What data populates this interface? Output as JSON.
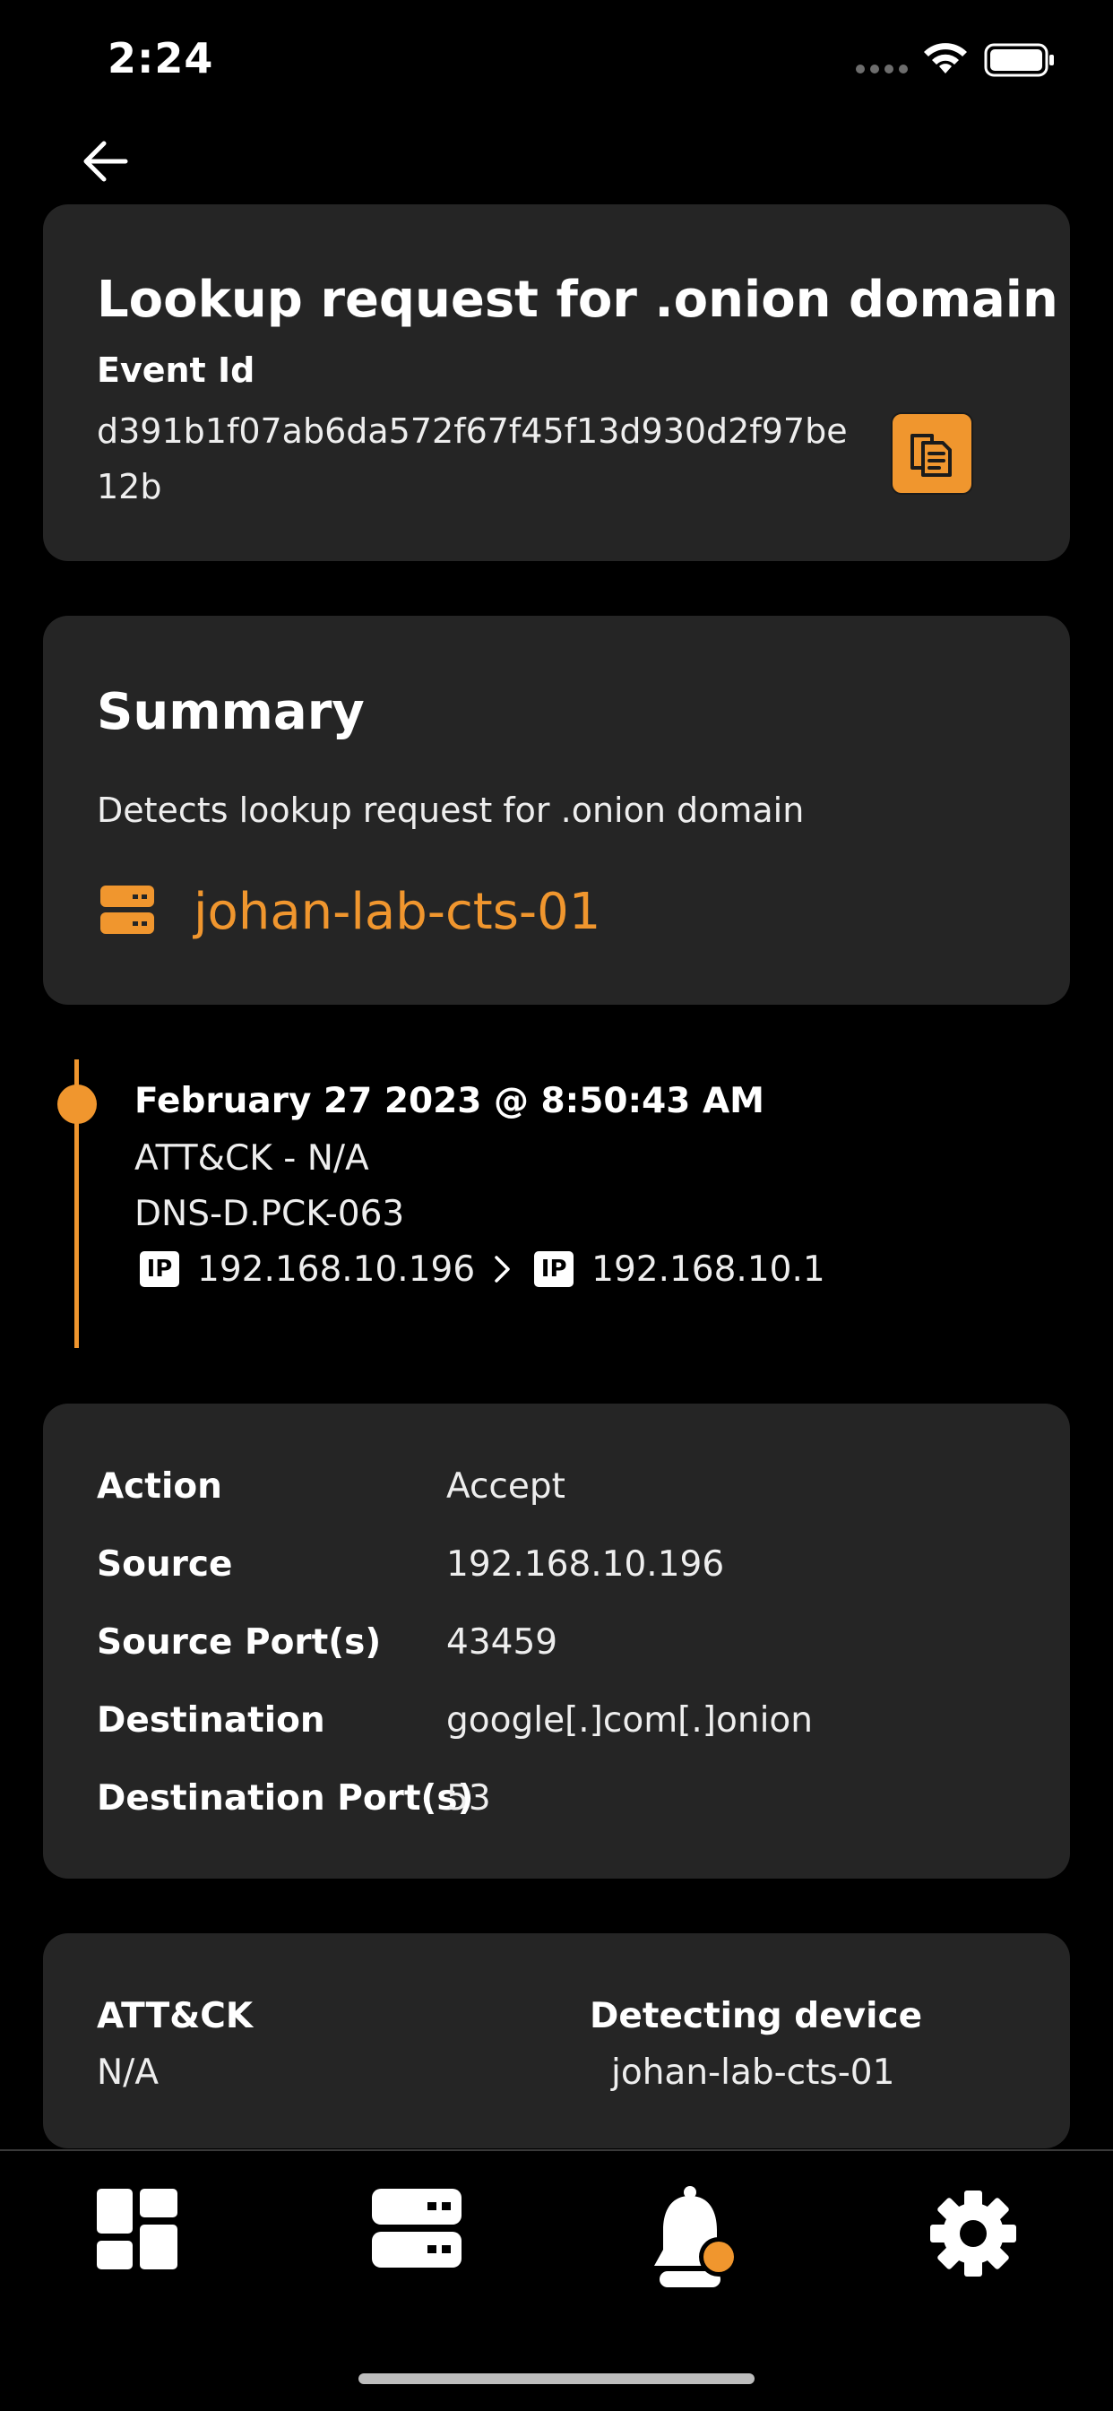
{
  "status_bar": {
    "time": "2:24"
  },
  "header": {
    "title": "Lookup request for .onion domain",
    "event_id_label": "Event Id",
    "event_id": "d391b1f07ab6da572f67f45f13d930d2f97be12b"
  },
  "summary": {
    "title": "Summary",
    "description": "Detects lookup request for .onion domain",
    "device": "johan-lab-cts-01"
  },
  "timeline": {
    "date": "February 27 2023 @ 8:50:43 AM",
    "attck": "ATT&CK - N/A",
    "rule": "DNS-D.PCK-063",
    "ip_badge": "IP",
    "source_ip": "192.168.10.196",
    "destination_ip": "192.168.10.1"
  },
  "details": {
    "rows": [
      {
        "label": "Action",
        "value": "Accept"
      },
      {
        "label": "Source",
        "value": "192.168.10.196"
      },
      {
        "label": "Source Port(s)",
        "value": "43459"
      },
      {
        "label": "Destination",
        "value": "google[.]com[.]onion"
      },
      {
        "label": "Destination Port(s)",
        "value": "53"
      }
    ]
  },
  "meta": {
    "attck_label": "ATT&CK",
    "attck_value": "N/A",
    "device_label": "Detecting device",
    "device_value": "johan-lab-cts-01"
  },
  "tab_bar": {
    "items": [
      {
        "icon": "dashboard-icon"
      },
      {
        "icon": "server-icon"
      },
      {
        "icon": "bell-icon",
        "active": true
      },
      {
        "icon": "gear-icon"
      }
    ]
  },
  "colors": {
    "accent": "#f0962e",
    "card_bg": "#252525",
    "background": "#000000"
  }
}
